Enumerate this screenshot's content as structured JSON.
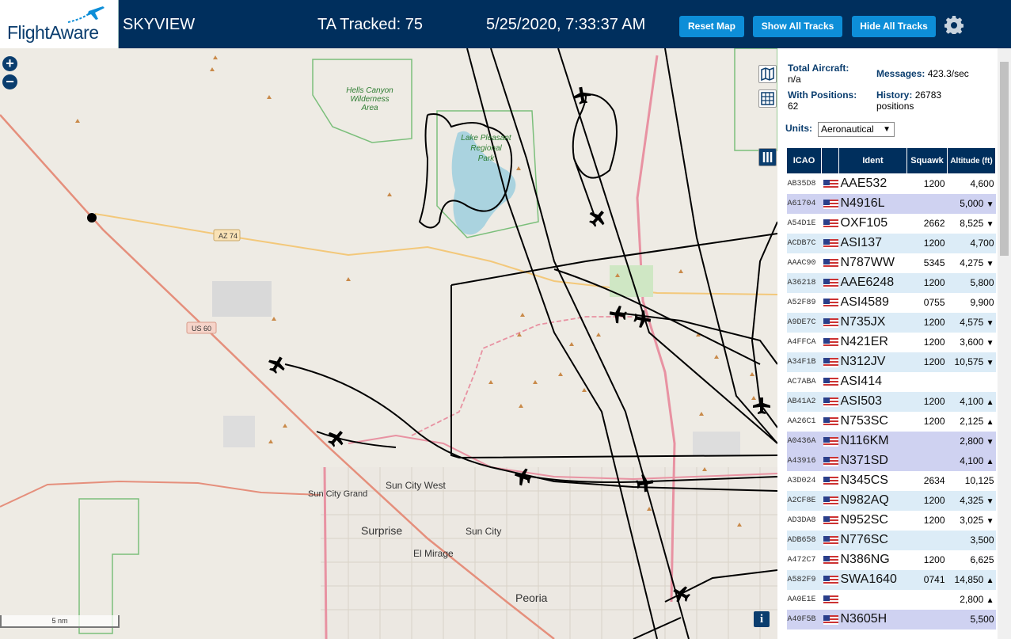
{
  "header": {
    "logo_text": "FlightAware",
    "app_name": "SKYVIEW",
    "tracked_label": "TA Tracked: 75",
    "datetime": "5/25/2020, 7:33:37 AM",
    "buttons": {
      "reset_map": "Reset Map",
      "show_all": "Show All Tracks",
      "hide_all": "Hide All Tracks"
    },
    "accent_color": "#0d8ed8",
    "bar_color": "#002f5d"
  },
  "map": {
    "scale_label": "5 nm",
    "place_labels": {
      "hells_canyon": [
        "Hells Canyon",
        "Wilderness",
        "Area"
      ],
      "lake_pleasant": [
        "Lake Pleasant",
        "Regional",
        "Park"
      ],
      "sun_city_west": "Sun City West",
      "sun_city_grand": "Sun City Grand",
      "surprise": "Surprise",
      "sun_city": "Sun City",
      "el_mirage": "El Mirage",
      "peoria": "Peoria"
    },
    "road_shields": {
      "az74": "AZ 74",
      "us60": "US 60"
    },
    "controls": {
      "zoom_in": "+",
      "zoom_out": "−",
      "info": "i"
    }
  },
  "panel": {
    "total_aircraft_label": "Total Aircraft:",
    "total_aircraft_value": "n/a",
    "with_positions_label": "With Positions:",
    "with_positions_value": "62",
    "messages_label": "Messages:",
    "messages_value": "423.3/sec",
    "history_label": "History:",
    "history_value": "26783",
    "history_unit": "positions",
    "units_label": "Units:",
    "units_value": "Aeronautical",
    "columns": {
      "icao": "ICAO",
      "flag": "",
      "ident": "Ident",
      "squawk": "Squawk",
      "altitude": "Altitude (ft)"
    },
    "rows": [
      {
        "icao": "AB35D8",
        "ident": "AAE532",
        "squawk": "1200",
        "alt": "4,600",
        "trend": "",
        "style": "r"
      },
      {
        "icao": "A61704",
        "ident": "N4916L",
        "squawk": "",
        "alt": "5,000",
        "trend": "▼",
        "style": "p"
      },
      {
        "icao": "A54D1E",
        "ident": "OXF105",
        "squawk": "2662",
        "alt": "8,525",
        "trend": "▼",
        "style": "r"
      },
      {
        "icao": "ACDB7C",
        "ident": "ASI137",
        "squawk": "1200",
        "alt": "4,700",
        "trend": "",
        "style": "b"
      },
      {
        "icao": "AAAC90",
        "ident": "N787WW",
        "squawk": "5345",
        "alt": "4,275",
        "trend": "▼",
        "style": "r"
      },
      {
        "icao": "A36218",
        "ident": "AAE6248",
        "squawk": "1200",
        "alt": "5,800",
        "trend": "",
        "style": "b"
      },
      {
        "icao": "A52F89",
        "ident": "ASI4589",
        "squawk": "0755",
        "alt": "9,900",
        "trend": "",
        "style": "r"
      },
      {
        "icao": "A9DE7C",
        "ident": "N735JX",
        "squawk": "1200",
        "alt": "4,575",
        "trend": "▼",
        "style": "b"
      },
      {
        "icao": "A4FFCA",
        "ident": "N421ER",
        "squawk": "1200",
        "alt": "3,600",
        "trend": "▼",
        "style": "r"
      },
      {
        "icao": "A34F1B",
        "ident": "N312JV",
        "squawk": "1200",
        "alt": "10,575",
        "trend": "▼",
        "style": "b"
      },
      {
        "icao": "AC7ABA",
        "ident": "ASI414",
        "squawk": "",
        "alt": "",
        "trend": "",
        "style": "r"
      },
      {
        "icao": "AB41A2",
        "ident": "ASI503",
        "squawk": "1200",
        "alt": "4,100",
        "trend": "▲",
        "style": "b"
      },
      {
        "icao": "AA26C1",
        "ident": "N753SC",
        "squawk": "1200",
        "alt": "2,125",
        "trend": "▲",
        "style": "r"
      },
      {
        "icao": "A0436A",
        "ident": "N116KM",
        "squawk": "",
        "alt": "2,800",
        "trend": "▼",
        "style": "p"
      },
      {
        "icao": "A43916",
        "ident": "N371SD",
        "squawk": "",
        "alt": "4,100",
        "trend": "▲",
        "style": "p"
      },
      {
        "icao": "A3D024",
        "ident": "N345CS",
        "squawk": "2634",
        "alt": "10,125",
        "trend": "",
        "style": "r"
      },
      {
        "icao": "A2CF8E",
        "ident": "N982AQ",
        "squawk": "1200",
        "alt": "4,325",
        "trend": "▼",
        "style": "b"
      },
      {
        "icao": "AD3DA8",
        "ident": "N952SC",
        "squawk": "1200",
        "alt": "3,025",
        "trend": "▼",
        "style": "r"
      },
      {
        "icao": "ADB658",
        "ident": "N776SC",
        "squawk": "",
        "alt": "3,500",
        "trend": "",
        "style": "b"
      },
      {
        "icao": "A472C7",
        "ident": "N386NG",
        "squawk": "1200",
        "alt": "6,625",
        "trend": "",
        "style": "r"
      },
      {
        "icao": "A582F9",
        "ident": "SWA1640",
        "squawk": "0741",
        "alt": "14,850",
        "trend": "▲",
        "style": "b"
      },
      {
        "icao": "AA0E1E",
        "ident": "",
        "squawk": "",
        "alt": "2,800",
        "trend": "▲",
        "style": "r"
      },
      {
        "icao": "A40F5B",
        "ident": "N3605H",
        "squawk": "",
        "alt": "5,500",
        "trend": "",
        "style": "p"
      }
    ]
  }
}
